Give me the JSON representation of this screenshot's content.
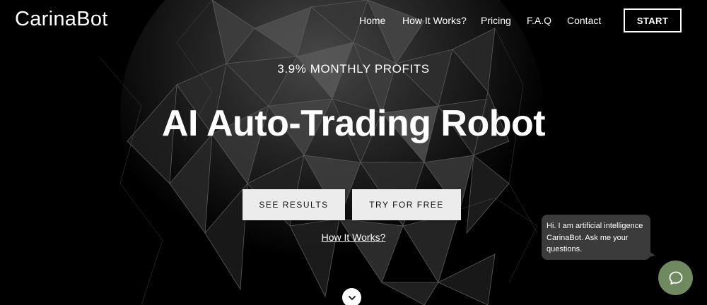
{
  "brand": {
    "name": "CarinaBot"
  },
  "nav": {
    "items": [
      {
        "label": "Home"
      },
      {
        "label": "How It Works?"
      },
      {
        "label": "Pricing"
      },
      {
        "label": "F.A.Q"
      },
      {
        "label": "Contact"
      }
    ],
    "start_label": "START"
  },
  "hero": {
    "eyebrow": "3.9% MONTHLY PROFITS",
    "headline": "AI Auto-Trading Robot",
    "see_results_label": "SEE RESULTS",
    "try_free_label": "TRY FOR FREE",
    "how_link": "How It Works?",
    "scroll_icon": "chevron-down-icon"
  },
  "chat": {
    "message": "Hi. I am artificial intelligence CarinaBot. Ask me your questions.",
    "launcher_icon": "chat-icon",
    "launcher_color": "#6f8a5f"
  }
}
